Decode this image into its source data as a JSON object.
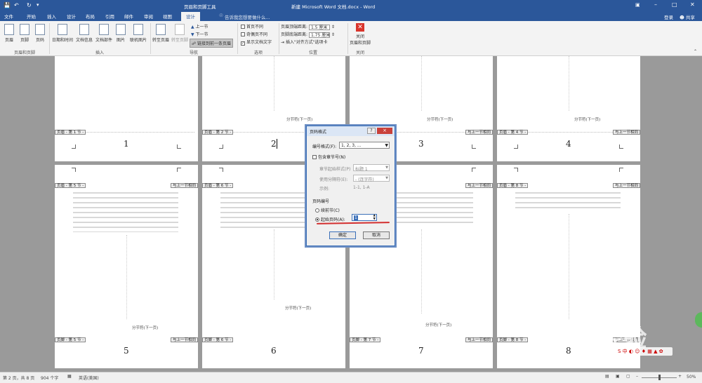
{
  "titlebar": {
    "context_tool": "页眉和页脚工具",
    "doc_title": "新建 Microsoft Word 文档.docx - Word",
    "login": "登录",
    "share": "共享"
  },
  "tabs": [
    "文件",
    "开始",
    "插入",
    "设计",
    "布局",
    "引用",
    "邮件",
    "审阅",
    "视图",
    "设计"
  ],
  "tell_me": "告诉我您想要做什么...",
  "ribbon": {
    "btn_header": "页眉",
    "btn_footer": "页脚",
    "btn_pagenum": "页码",
    "btn_datetime": "日期和时间",
    "btn_docinfo": "文档信息",
    "btn_docparts": "文档部件",
    "btn_picture": "图片",
    "btn_onlinepic": "联机图片",
    "btn_gotoheader": "转至页眉",
    "btn_gotofooter": "转至页脚",
    "btn_prev": "上一节",
    "btn_next": "下一节",
    "btn_link": "链接到前一条页眉",
    "opt_firstpage": "首页不同",
    "opt_oddeven": "奇偶页不同",
    "opt_showtext": "显示文档文字",
    "header_top_label": "页眉顶端距离:",
    "header_top_value": "1.5 厘米",
    "footer_bottom_label": "页脚底端距离:",
    "footer_bottom_value": "1.75 厘米",
    "insert_align_tab": "插入\"对齐方式\"选项卡",
    "btn_close_1": "关闭",
    "btn_close_2": "页眉和页脚",
    "groups": [
      "页眉和页脚",
      "插入",
      "导航",
      "选项",
      "位置",
      "关闭"
    ]
  },
  "pages_row1": [
    {
      "header": "页眉 - 第 1 节 -",
      "num": "1",
      "same": ""
    },
    {
      "header": "页眉 - 第 2 节 -",
      "num": "2",
      "same": ""
    },
    {
      "header": "",
      "num": "3",
      "same": "与上一节相同"
    },
    {
      "header": "页眉 - 第 4 节 -",
      "num": "4",
      "same": "与上一节相同"
    }
  ],
  "pages_row2": [
    {
      "header": "页眉 - 第 5 节 -",
      "footer": "页脚 - 第 5 节 -",
      "num": "5",
      "same": "与上一节相同"
    },
    {
      "header": "页眉 - 第 6 节 -",
      "footer": "页脚 - 第 6 节 -",
      "num": "6",
      "same": ""
    },
    {
      "header": "",
      "footer": "页脚 - 第 7 节 -",
      "num": "7",
      "same": "与上一节相同"
    },
    {
      "header": "页眉 - 第 8 节 -",
      "footer": "页脚 - 第 8 节 -",
      "num": "8",
      "same": "与上一节相同"
    }
  ],
  "section_break": "分节符(下一页)",
  "dialog": {
    "title": "页码格式",
    "help": "?",
    "close": "×",
    "format_label": "编号格式(F):",
    "format_value": "1, 2, 3, ...",
    "include_chapter": "包含章节号(N)",
    "chapter_style_label": "章节起始样式(P)",
    "chapter_style_value": "标题 1",
    "separator_label": "使用分隔符(E):",
    "separator_value": "-  (连字符)",
    "example_label": "示例:",
    "example_value": "1-1, 1-A",
    "numbering_label": "页码编号",
    "continue_label": "续前节(C)",
    "start_at_label": "起始页码(A):",
    "start_at_value": "1",
    "ok": "确定",
    "cancel": "取消"
  },
  "statusbar": {
    "page": "第 2 页，共 8 页",
    "words": "904 个字",
    "lang": "英语(美国)",
    "zoom": "50%"
  }
}
